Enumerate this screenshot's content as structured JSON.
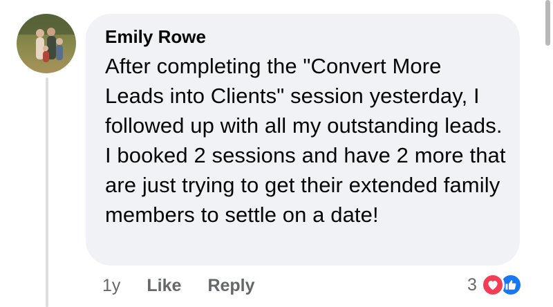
{
  "comment": {
    "author": "Emily Rowe",
    "text": "After completing the \"Convert More Leads into Clients\" session yesterday, I followed up with all my outstanding leads. I booked 2 sessions and have 2 more that are just trying to get their extended family members to settle on a date!",
    "timestamp": "1y",
    "like_label": "Like",
    "reply_label": "Reply",
    "reaction_count": "3",
    "reactions": [
      "love-icon",
      "like-icon"
    ]
  },
  "colors": {
    "bubble": "#f0f2f5",
    "meta_text": "#65676b",
    "love": "#f33e58",
    "like": "#1877f2"
  }
}
